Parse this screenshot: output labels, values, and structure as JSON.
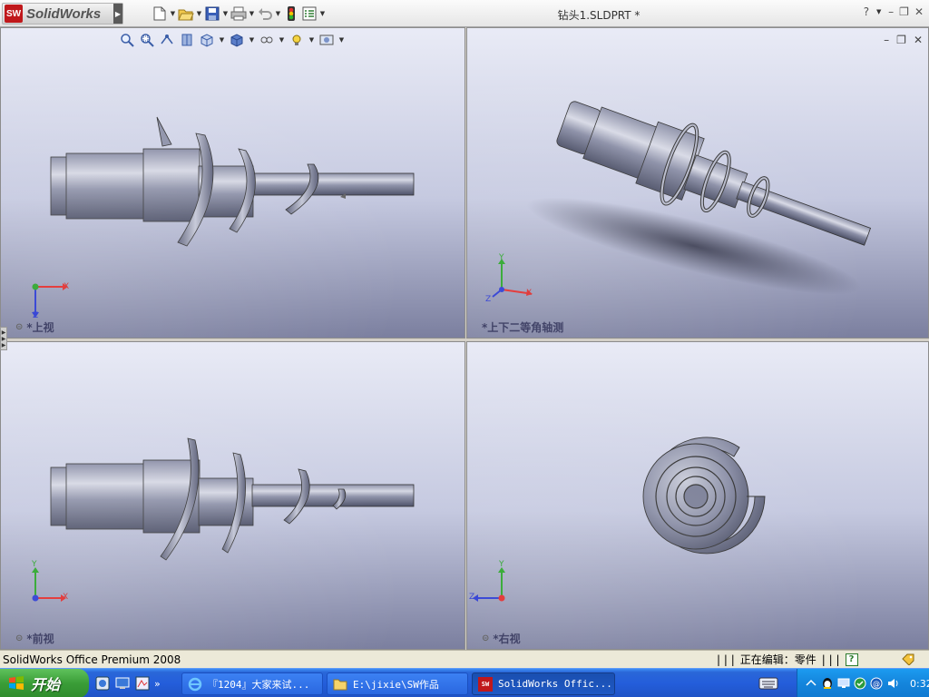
{
  "app": {
    "logo_text": "SolidWorks",
    "window_title": "钻头1.SLDPRT *"
  },
  "toolbar": {
    "icons": [
      "new-icon",
      "open-icon",
      "save-icon",
      "print-icon",
      "undo-icon",
      "rebuild-icon",
      "options-icon"
    ]
  },
  "window_controls": {
    "help": "?",
    "minimize": "–",
    "restore": "❐",
    "close": "✕"
  },
  "view_toolbar": {
    "icons": [
      "zoom-to-fit-icon",
      "zoom-area-icon",
      "previous-view-icon",
      "section-view-icon",
      "view-orientation-icon",
      "display-style-icon",
      "hide-show-icon",
      "lights-icon",
      "scene-icon"
    ]
  },
  "viewports": {
    "top": {
      "label": "*上视",
      "triad": {
        "a": "X",
        "b": "Z"
      }
    },
    "iso": {
      "label": "*上下二等角轴测",
      "triad": {
        "a": "X",
        "b": "Y",
        "c": "Z"
      }
    },
    "front": {
      "label": "*前视",
      "triad": {
        "a": "X",
        "b": "Y"
      }
    },
    "right": {
      "label": "*右视",
      "triad": {
        "a": "Z",
        "b": "Y"
      }
    }
  },
  "status_bar": {
    "product": "SolidWorks Office Premium 2008",
    "separators": "| | |",
    "editing": "正在编辑：零件",
    "separators2": "| | |",
    "help": "?"
  },
  "taskbar": {
    "start_label": "开始",
    "tasks": [
      {
        "label": "『1204』大家来试..."
      },
      {
        "label": "E:\\jixie\\SW作品"
      },
      {
        "label": "SolidWorks Offic..."
      }
    ],
    "clock": "0:32",
    "quick_more": "»"
  },
  "colors": {
    "taskbar": "#245edb",
    "start": "#3a9d37",
    "brand_red": "#c0181b",
    "axis_red": "#e02020",
    "axis_green": "#1ea01e",
    "axis_blue": "#2030d0"
  }
}
